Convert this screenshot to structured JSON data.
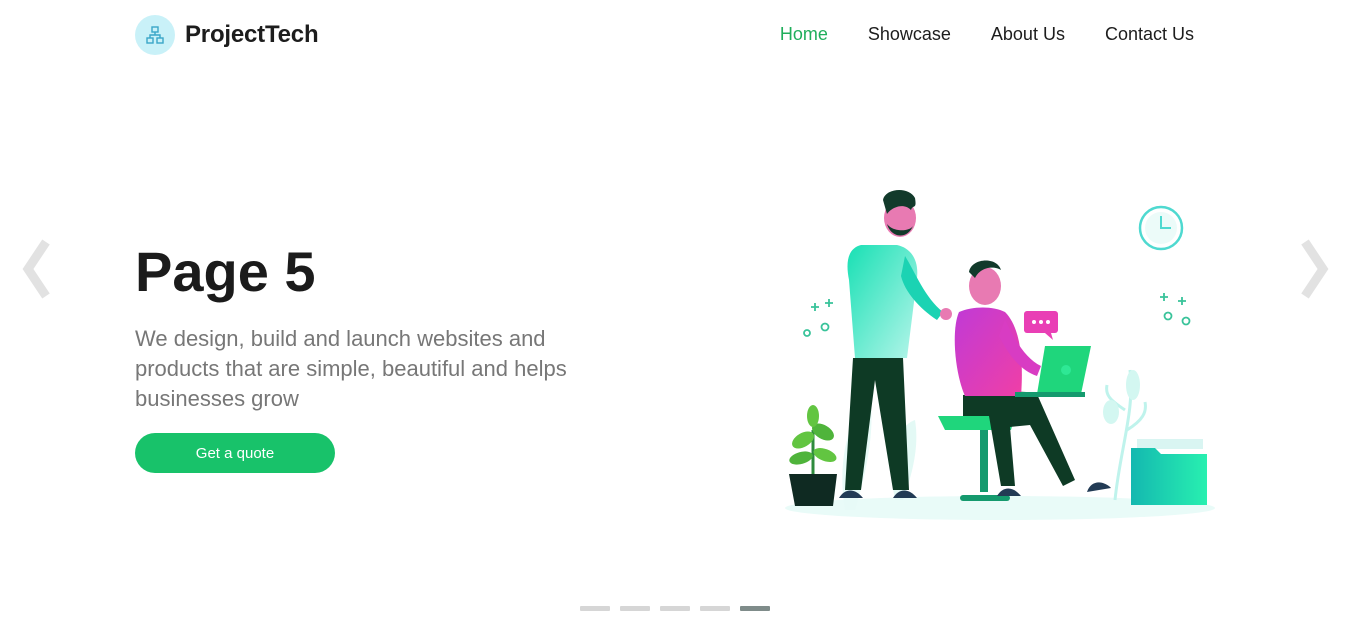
{
  "brand": {
    "name": "ProjectTech",
    "logo_icon": "sitemap-icon",
    "colors": {
      "accent": "#18c26a",
      "nav_active": "#1fae5b",
      "logo_bg": "#c9f1f8"
    }
  },
  "nav": {
    "items": [
      {
        "label": "Home",
        "active": true
      },
      {
        "label": "Showcase",
        "active": false
      },
      {
        "label": "About Us",
        "active": false
      },
      {
        "label": "Contact Us",
        "active": false
      }
    ]
  },
  "hero": {
    "title": "Page 5",
    "description": "We design, build and launch websites and products that are simple, beautiful and helps businesses grow",
    "cta_label": "Get a quote",
    "illustration": "team-working-illustration"
  },
  "carousel": {
    "prev_icon": "chevron-left-icon",
    "next_icon": "chevron-right-icon",
    "slide_count": 5,
    "active_slide": 5
  }
}
